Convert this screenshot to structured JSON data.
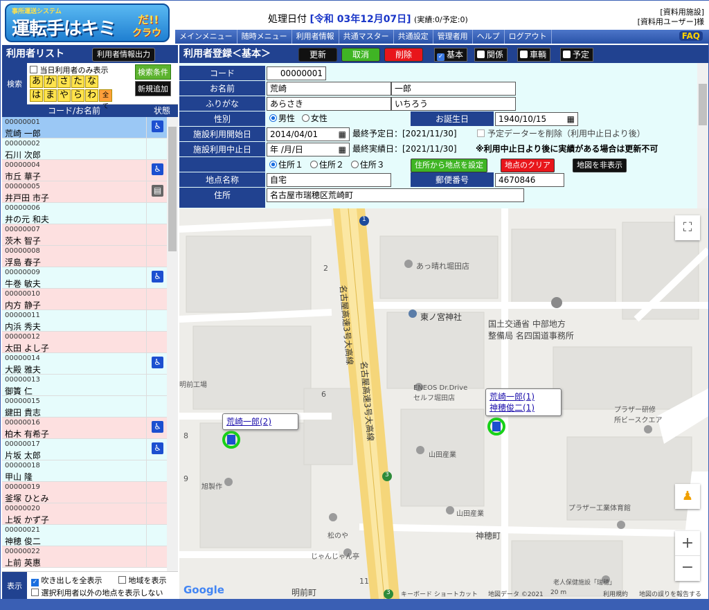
{
  "header": {
    "logo_sub": "事所運送システム",
    "logo_main": "運転手はキミ",
    "logo_da": "だ!!",
    "logo_cloud": "クラウド",
    "proc_label": "処理日付",
    "proc_date": "[令和 03年12月07日]",
    "proc_count": "(実績:0/予定:0)",
    "facility": "[資料用施設]",
    "user": "[資料用ユーザー]様",
    "faq": "FAQ"
  },
  "menu": [
    "メインメニュー",
    "随時メニュー",
    "利用者情報",
    "共通マスター",
    "共通設定",
    "管理者用",
    "ヘルプ",
    "ログアウト"
  ],
  "left": {
    "title": "利用者リスト",
    "export_button": "利用者情報出力",
    "search_label": "検索",
    "today_only": "当日利用者のみ表示",
    "kana_row1": [
      "あ",
      "か",
      "さ",
      "た",
      "な"
    ],
    "kana_row2": [
      "は",
      "ま",
      "や",
      "ら",
      "わ",
      "全て"
    ],
    "search_cond": "検索条件",
    "new_add": "新規追加",
    "col_code": "コード/お名前",
    "col_state": "状態",
    "users": [
      {
        "code": "00000001",
        "name": "荒崎 一郎",
        "bg": "sel",
        "icon": "wheelchair-icon"
      },
      {
        "code": "00000002",
        "name": "石川 次郎",
        "bg": "cyan",
        "icon": ""
      },
      {
        "code": "00000004",
        "name": "市丘 華子",
        "bg": "pink",
        "icon": "wheelchair-icon"
      },
      {
        "code": "00000005",
        "name": "井戸田 市子",
        "bg": "pink",
        "icon": "stretcher-icon"
      },
      {
        "code": "00000006",
        "name": "井の元 和夫",
        "bg": "cyan",
        "icon": ""
      },
      {
        "code": "00000007",
        "name": "茨木 智子",
        "bg": "pink",
        "icon": ""
      },
      {
        "code": "00000008",
        "name": "浮島 春子",
        "bg": "pink",
        "icon": ""
      },
      {
        "code": "00000009",
        "name": "牛巻 敏夫",
        "bg": "cyan",
        "icon": "wheelchair-icon"
      },
      {
        "code": "00000010",
        "name": "内方 静子",
        "bg": "pink",
        "icon": ""
      },
      {
        "code": "00000011",
        "name": "内浜 秀夫",
        "bg": "cyan",
        "icon": ""
      },
      {
        "code": "00000012",
        "name": "太田 よし子",
        "bg": "pink",
        "icon": ""
      },
      {
        "code": "00000014",
        "name": "大殿 雅夫",
        "bg": "cyan",
        "icon": "wheelchair-icon"
      },
      {
        "code": "00000013",
        "name": "御簀 仁",
        "bg": "cyan",
        "icon": ""
      },
      {
        "code": "00000015",
        "name": "鍵田 貴志",
        "bg": "cyan",
        "icon": ""
      },
      {
        "code": "00000016",
        "name": "柏木 有希子",
        "bg": "pink",
        "icon": "wheelchair-icon"
      },
      {
        "code": "00000017",
        "name": "片坂 太郎",
        "bg": "cyan",
        "icon": "wheelchair-icon"
      },
      {
        "code": "00000018",
        "name": "甲山 隆",
        "bg": "cyan",
        "icon": ""
      },
      {
        "code": "00000019",
        "name": "釜塚 ひとみ",
        "bg": "pink",
        "icon": ""
      },
      {
        "code": "00000020",
        "name": "上坂 かず子",
        "bg": "pink",
        "icon": ""
      },
      {
        "code": "00000021",
        "name": "神穂 俊二",
        "bg": "cyan",
        "icon": ""
      },
      {
        "code": "00000022",
        "name": "上前 英惠",
        "bg": "pink",
        "icon": ""
      }
    ],
    "disp_label": "表示",
    "opt_balloon": "吹き出しを全表示",
    "opt_area": "地域を表示",
    "opt_hide": "選択利用者以外の地点を表示しない"
  },
  "right": {
    "title": "利用者登録＜基本＞",
    "btn_update": "更新",
    "btn_cancel": "取消",
    "btn_delete": "削除",
    "tab_basic": "基本",
    "tab_relation": "関係",
    "tab_vehicle": "車輌",
    "tab_plan": "予定",
    "lbl_code": "コード",
    "val_code": "00000001",
    "lbl_name": "お名前",
    "val_last": "荒崎",
    "val_first": "一郎",
    "lbl_kana": "ふりがな",
    "val_kana_last": "あらさき",
    "val_kana_first": "いちろう",
    "lbl_gender": "性別",
    "gender_male": "男性",
    "gender_female": "女性",
    "lbl_birthday": "お誕生日",
    "val_birthday": "1940/10/15",
    "lbl_start": "施設利用開始日",
    "val_start": "2014/04/01",
    "last_plan": "最終予定日：[2021/11/30]",
    "delete_plan": "予定データーを削除（利用中止日より後）",
    "lbl_stop": "施設利用中止日",
    "val_stop": "年 /月/日",
    "last_result": "最終実績日：[2021/11/30]",
    "stop_note": "※利用中止日より後に実績がある場合は更新不可",
    "addr1": "住所１",
    "addr2": "住所２",
    "addr3": "住所３",
    "btn_setpoint": "住所から地点を設定",
    "btn_clearpoint": "地点のクリア",
    "btn_hidemap": "地図を非表示",
    "lbl_point": "地点名称",
    "val_point": "自宅",
    "lbl_zip": "郵便番号",
    "val_zip": "4670846",
    "lbl_addr": "住所",
    "val_addr": "名古屋市瑞穂区荒崎町"
  },
  "map": {
    "labels": {
      "highway1": "名古屋高速3号大高線",
      "highway2": "名古屋高速3号大高線",
      "shop1": "あっ晴れ堀田店",
      "shrine": "東ノ宮神社",
      "office": "国土交通省 中部地方\n整備局 名四国道事務所",
      "eneos": "ENEOS Dr.Drive\nセルフ堀田店",
      "plaza": "プラザー研修\n所ビースクエア",
      "yamada": "山田産業",
      "yamada2": "山田産業",
      "asahi": "旭製作",
      "plaza2": "プラザー工業体育館",
      "kanho": "神穂町",
      "matsu": "松のや",
      "jyan": "じゃんじゃん亭",
      "meizen": "明前町",
      "kojo": "明前工場",
      "rojin": "老人保健施設「瑞穂」",
      "n2": "2",
      "n6": "6",
      "n8": "8",
      "n9": "9",
      "n11": "11",
      "n3": "3",
      "n1": "1",
      "n3b": "3"
    },
    "bubble1": [
      "荒崎一郎(2)"
    ],
    "bubble2": [
      "荒崎一郎(1)",
      "神穂俊二(1)"
    ],
    "footer": {
      "shortcut": "キーボード ショートカット",
      "data": "地図データ ©2021",
      "scale": "20 m",
      "terms": "利用規約",
      "report": "地図の誤りを報告する",
      "google": "Google"
    }
  }
}
